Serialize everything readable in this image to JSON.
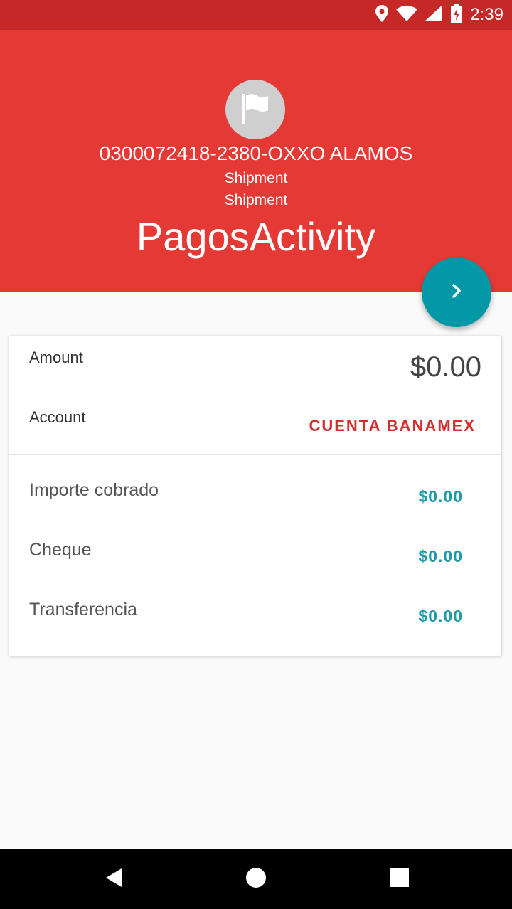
{
  "status_bar": {
    "time": "2:39",
    "icons": [
      "location-icon",
      "wifi-icon",
      "signal-icon",
      "battery-charging-icon"
    ]
  },
  "header": {
    "avatar_icon": "flag-icon",
    "store": "0300072418-2380-OXXO ALAMOS",
    "line2": "Shipment",
    "line3": "Shipment",
    "title": "PagosActivity",
    "colors": {
      "header": "#e53935",
      "status_bar": "#c62828",
      "fab": "#0097a7"
    }
  },
  "fab": {
    "icon": "chevron-right-icon"
  },
  "card": {
    "amount_label": "Amount",
    "amount_value": "$0.00",
    "account_label": "Account",
    "account_value": "CUENTA BANAMEX",
    "rows": [
      {
        "label": "Importe cobrado",
        "value": "$0.00"
      },
      {
        "label": "Cheque",
        "value": "$0.00"
      },
      {
        "label": "Transferencia",
        "value": "$0.00"
      }
    ]
  },
  "nav_bar": {
    "icons": [
      "back-icon",
      "home-icon",
      "recents-icon"
    ]
  }
}
